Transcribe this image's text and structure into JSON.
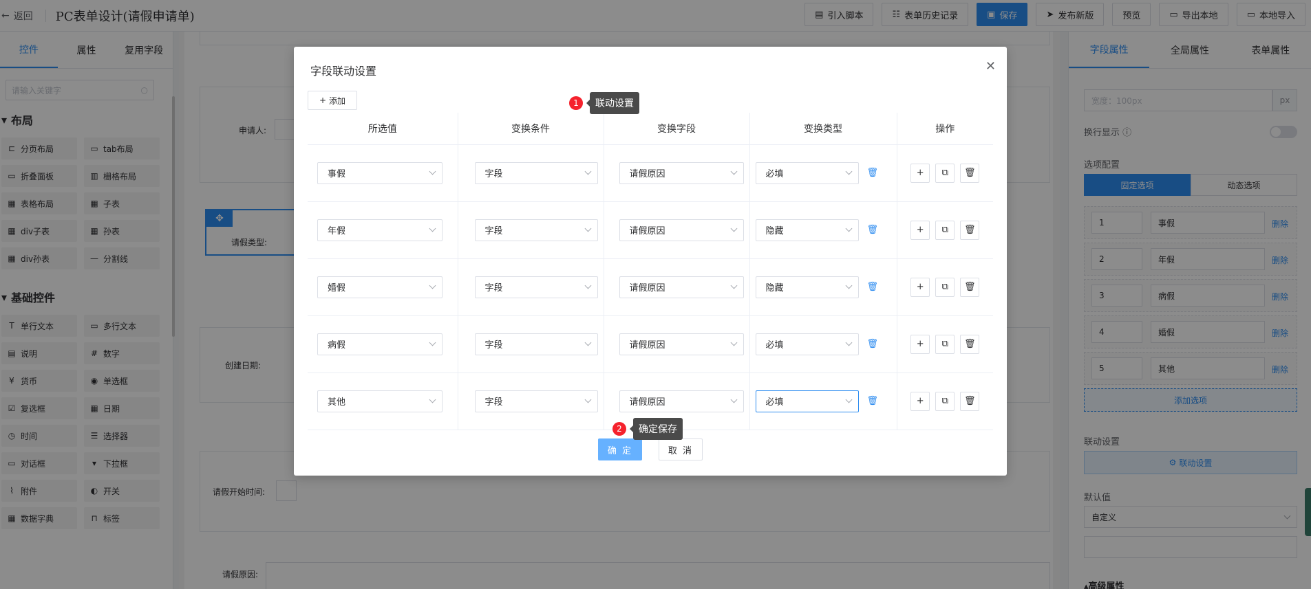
{
  "topbar": {
    "back_label": "返回",
    "title": "PC表单设计(请假申请单)",
    "buttons": [
      "引入脚本",
      "表单历史记录",
      "保存",
      "发布新版",
      "预览",
      "导出本地",
      "本地导入"
    ]
  },
  "left_panel": {
    "tabs": [
      "控件",
      "属性",
      "复用字段"
    ],
    "search_placeholder": "请输入关键字",
    "layout_section": "布局",
    "layout_items": [
      "分页布局",
      "tab布局",
      "折叠面板",
      "栅格布局",
      "表格布局",
      "子表",
      "div子表",
      "孙表",
      "div孙表",
      "分割线"
    ],
    "basic_section": "基础控件",
    "basic_items": [
      "单行文本",
      "多行文本",
      "说明",
      "数字",
      "货币",
      "单选框",
      "复选框",
      "日期",
      "时间",
      "选择器",
      "对话框",
      "下拉框",
      "附件",
      "开关",
      "数据字典",
      "标签"
    ]
  },
  "canvas": {
    "applicant_label": "申请人:",
    "leave_type_label": "请假类型:",
    "create_date_label": "创建日期:",
    "start_time_label": "请假开始时间:",
    "reason_label": "请假原因:"
  },
  "right_panel": {
    "tabs": [
      "字段属性",
      "全局属性",
      "表单属性"
    ],
    "width_placeholder": "宽度：100px",
    "width_unit": "px",
    "wrap_label": "换行显示",
    "options_label": "选项配置",
    "fixed_options": "固定选项",
    "dynamic_options": "动态选项",
    "options": [
      {
        "value": "1",
        "label": "事假"
      },
      {
        "value": "2",
        "label": "年假"
      },
      {
        "value": "3",
        "label": "病假"
      },
      {
        "value": "4",
        "label": "婚假"
      },
      {
        "value": "5",
        "label": "其他"
      }
    ],
    "delete_label": "删除",
    "add_option": "添加选项",
    "linkage_label": "联动设置",
    "linkage_button": "联动设置",
    "default_label": "默认值",
    "default_value": "自定义",
    "advanced_label": "高级属性"
  },
  "modal": {
    "title": "字段联动设置",
    "add_button": "添加",
    "columns": [
      "所选值",
      "变换条件",
      "变换字段",
      "变换类型",
      "操作"
    ],
    "rows": [
      {
        "value": "事假",
        "condition": "字段",
        "field": "请假原因",
        "type": "必填"
      },
      {
        "value": "年假",
        "condition": "字段",
        "field": "请假原因",
        "type": "隐藏"
      },
      {
        "value": "婚假",
        "condition": "字段",
        "field": "请假原因",
        "type": "隐藏"
      },
      {
        "value": "病假",
        "condition": "字段",
        "field": "请假原因",
        "type": "必填"
      },
      {
        "value": "其他",
        "condition": "字段",
        "field": "请假原因",
        "type": "必填"
      }
    ],
    "ok_button": "确 定",
    "cancel_button": "取 消"
  },
  "annotations": [
    {
      "number": "1",
      "text": "联动设置"
    },
    {
      "number": "2",
      "text": "确定保存"
    }
  ]
}
